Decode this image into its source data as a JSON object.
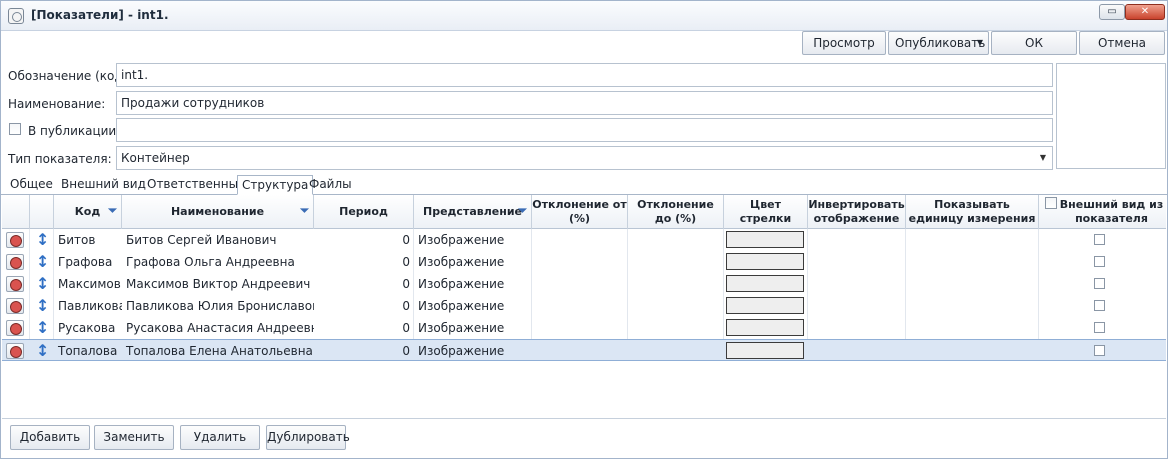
{
  "window": {
    "title": "[Показатели] - int1.",
    "restore_glyph": "▭",
    "close_glyph": "✕"
  },
  "toolbar": {
    "preview_label": "Просмотр",
    "publish_label": "Опубликовать",
    "ok_label": "ОК",
    "cancel_label": "Отмена"
  },
  "form": {
    "code_label": "Обозначение (код):",
    "code_value": "int1.",
    "name_label": "Наименование:",
    "name_value": "Продажи сотрудников",
    "publication_label": "В публикации:",
    "publication_value": "",
    "type_label": "Тип показателя:",
    "type_value": "Контейнер"
  },
  "tabs": [
    {
      "label": "Общее"
    },
    {
      "label": "Внешний вид"
    },
    {
      "label": "Ответственные"
    },
    {
      "label": "Структура",
      "active": true
    },
    {
      "label": "Файлы"
    }
  ],
  "grid": {
    "columns": {
      "code": "Код",
      "name": "Наименование",
      "period": "Период",
      "representation": "Представление",
      "deviation_from": "Отклонение от (%)",
      "deviation_to": "Отклонение до (%)",
      "arrow_color": "Цвет стрелки",
      "invert": "Инвертировать отображение",
      "show_unit": "Показывать единицу измерения",
      "appearance_from": "Внешний вид из показателя"
    },
    "rows": [
      {
        "code": "Битов",
        "name": "Битов Сергей Иванович",
        "period": "0",
        "representation": "Изображение"
      },
      {
        "code": "Графова",
        "name": "Графова Ольга Андреевна",
        "period": "0",
        "representation": "Изображение"
      },
      {
        "code": "Максимов",
        "name": "Максимов Виктор Андреевич",
        "period": "0",
        "representation": "Изображение"
      },
      {
        "code": "Павликова",
        "name": "Павликова Юлия Брониславовна",
        "period": "0",
        "representation": "Изображение"
      },
      {
        "code": "Русакова",
        "name": "Русакова Анастасия Андреевна",
        "period": "0",
        "representation": "Изображение"
      },
      {
        "code": "Топалова",
        "name": "Топалова Елена Анатольевна",
        "period": "0",
        "representation": "Изображение",
        "selected": true
      }
    ]
  },
  "actions": {
    "add_label": "Добавить",
    "replace_label": "Заменить",
    "delete_label": "Удалить",
    "duplicate_label": "Дублировать"
  },
  "colors": {
    "selection": "#dbe6f4",
    "accent": "#2f6fc4",
    "border": "#a3b4cb"
  }
}
